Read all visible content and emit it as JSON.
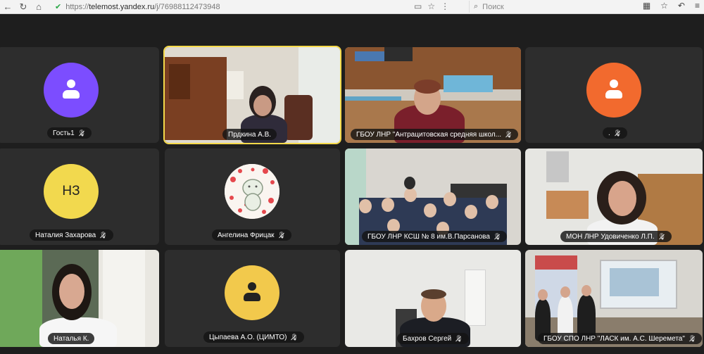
{
  "browser": {
    "url_host": "telemost.yandex.ru",
    "url_prefix": "https://",
    "url_path": "/j/76988112473948",
    "search_placeholder": "Поиск"
  },
  "participants": [
    {
      "name": "Гость1",
      "muted": true,
      "avatar": "person-icon",
      "color": "#7c4dff"
    },
    {
      "name": "Прдкина А.В.",
      "muted": false,
      "video": true,
      "active": true
    },
    {
      "name": "ГБОУ ЛНР \"Антрацитовская средняя школ...",
      "muted": true,
      "video": true
    },
    {
      "name": ".",
      "muted": true,
      "avatar": "person-icon",
      "color": "#f26a2e"
    },
    {
      "name": "Наталия Захарова",
      "muted": true,
      "avatar": "initials",
      "initials": "НЗ",
      "color": "#f2d94e"
    },
    {
      "name": "Ангелина Фрицак",
      "muted": true,
      "avatar": "image"
    },
    {
      "name": "ГБОУ ЛНР КСШ № 8 им.В.Парсанова",
      "muted": true,
      "video": true
    },
    {
      "name": "МОН ЛНР Удовиченко Л.П.",
      "muted": true,
      "video": true
    },
    {
      "name": "Наталья К.",
      "muted": false,
      "video": true
    },
    {
      "name": "Цыпаева А.О. (ЦИМТО)",
      "muted": true,
      "avatar": "person-icon",
      "color": "#f2c94c"
    },
    {
      "name": "Бахров Сергей",
      "muted": true,
      "video": true
    },
    {
      "name": "ГБОУ СПО ЛНР \"ЛАСК им. А.С. Шеремета\"",
      "muted": true,
      "video": true
    }
  ]
}
